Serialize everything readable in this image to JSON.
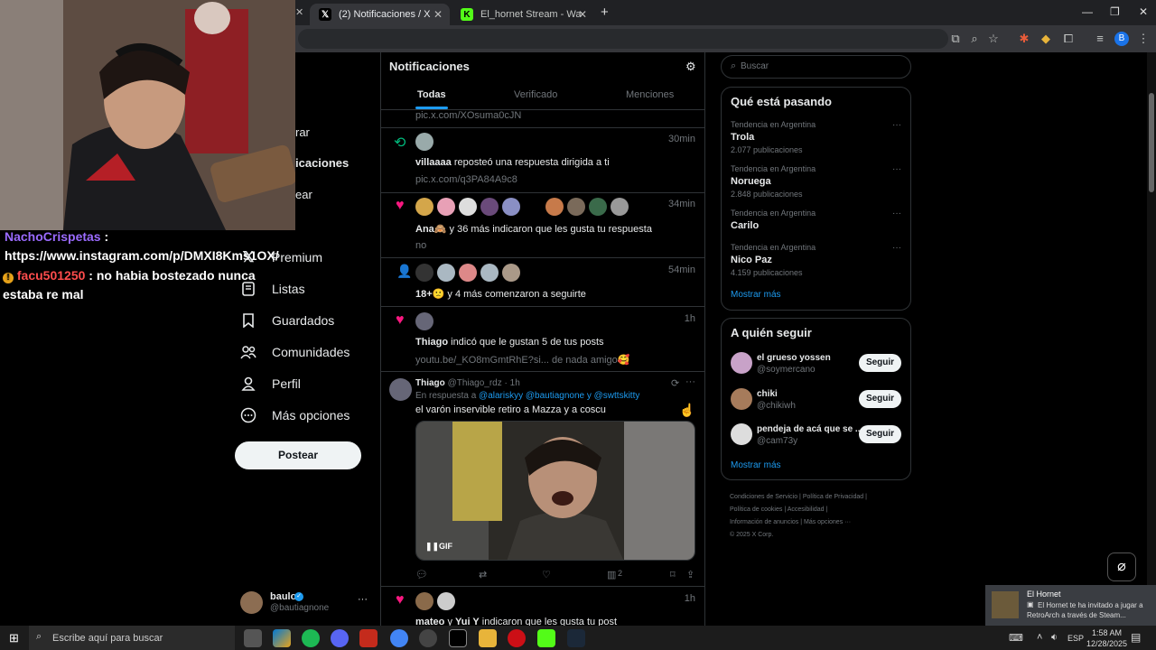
{
  "browser": {
    "tabs": [
      {
        "label": "(2) Notificaciones / X",
        "icon": "x-logo-icon",
        "active": true
      },
      {
        "label": "El_hornet Stream - Watch Live o",
        "icon": "kick-logo-icon",
        "active": false
      }
    ],
    "new_tab": "+",
    "window_controls": [
      "—",
      "❐",
      "✕"
    ]
  },
  "chat": {
    "messages": [
      {
        "user": "NachoCrispetas",
        "sep": " :",
        "text": "https://www.instagram.com/p/DMXI8Kms1OX/",
        "user_color": "#9b6bff"
      },
      {
        "badge": "!",
        "user": "facu501250",
        "sep": " : ",
        "text": "no habia bostezado nunca estaba re mal",
        "user_color": "#ff4d4d"
      }
    ]
  },
  "nav": {
    "partial": [
      "rar",
      "icaciones",
      "ear"
    ],
    "items": [
      {
        "label": "Premium",
        "icon": "x-logo-icon"
      },
      {
        "label": "Listas",
        "icon": "list-icon"
      },
      {
        "label": "Guardados",
        "icon": "bookmark-icon"
      },
      {
        "label": "Comunidades",
        "icon": "people-icon"
      },
      {
        "label": "Perfil",
        "icon": "person-icon"
      },
      {
        "label": "Más opciones",
        "icon": "more-circle-icon"
      }
    ],
    "post_button": "Postear",
    "account": {
      "name": "baulo",
      "handle": "@bautiagnone",
      "more": "···"
    }
  },
  "header": {
    "title": "Notificaciones",
    "tabs": [
      "Todas",
      "Verificado",
      "Menciones"
    ],
    "active_tab": "Todas"
  },
  "notifications": {
    "top_link": "pic.x.com/XOsuma0cJN",
    "items": [
      {
        "type": "repost",
        "time": "30min",
        "text_bold": "villaaaa",
        "text": " reposteó una respuesta dirigida a ti",
        "sub": "pic.x.com/q3PA84A9c8"
      },
      {
        "type": "like",
        "time": "34min",
        "text_bold": "Ana🙈",
        "text": " y 36 más indicaron que les gusta tu respuesta",
        "sub": "no"
      },
      {
        "type": "follow",
        "time": "54min",
        "text_bold": "18+🙁",
        "text": " y 4 más comenzaron a seguirte",
        "sub": ""
      },
      {
        "type": "like",
        "time": "1h",
        "text_bold": "Thiago",
        "text": " indicó que le gustan 5 de tus posts",
        "sub": "youtu.be/_KO8mGmtRhE?si... de nada amigo🥰"
      }
    ],
    "reply": {
      "name": "Thiago",
      "handle": "@Thiago_rdz",
      "dot": "·",
      "time": "1h",
      "reply_prefix": "En respuesta a ",
      "reply_to": "@alariskyy @bautiagnone y @swttskitty",
      "text": "el varón inservible retiro a Mazza y a coscu",
      "gif_label": "GIF",
      "views": "2"
    },
    "last": {
      "time": "1h",
      "text_bold": "mateo",
      "text": " y ",
      "text_bold2": "Yui Y",
      "text2": " indicaron que les gusta tu post"
    }
  },
  "sidebar": {
    "search_placeholder": "Buscar",
    "trending_title": "Qué está pasando",
    "trends": [
      {
        "meta": "Tendencia en Argentina",
        "name": "Trola",
        "count": "2.077 publicaciones"
      },
      {
        "meta": "Tendencia en Argentina",
        "name": "Noruega",
        "count": "2.848 publicaciones"
      },
      {
        "meta": "Tendencia en Argentina",
        "name": "Carilo",
        "count": ""
      },
      {
        "meta": "Tendencia en Argentina",
        "name": "Nico Paz",
        "count": "4.159 publicaciones"
      }
    ],
    "show_more": "Mostrar más",
    "follow_title": "A quién seguir",
    "follow": [
      {
        "name": "el grueso yossen",
        "handle": "@soymercano",
        "button": "Seguir"
      },
      {
        "name": "chiki",
        "handle": "@chikiwh",
        "button": "Seguir"
      },
      {
        "name": "pendeja de acá que se ...",
        "handle": "@cam73y",
        "button": "Seguir"
      }
    ],
    "follow_more": "Mostrar más",
    "footer": [
      "Condiciones de Servicio",
      "Política de Privacidad",
      "Política de cookies",
      "Accesibilidad",
      "Información de anuncios",
      "Más opciones ···",
      "© 2025 X Corp."
    ]
  },
  "toast": {
    "title": "El Hornet",
    "text": "El Hornet te ha invitado a jugar a RetroArch a través de Steam..."
  },
  "taskbar": {
    "search_placeholder": "Escribe aquí para buscar",
    "lang": "ESP",
    "time": "1:58 AM",
    "date": "12/28/2025"
  },
  "colors": {
    "accent": "#1d9bf0",
    "like": "#f91880",
    "repost": "#00ba7c",
    "follow": "#1d9bf0"
  }
}
